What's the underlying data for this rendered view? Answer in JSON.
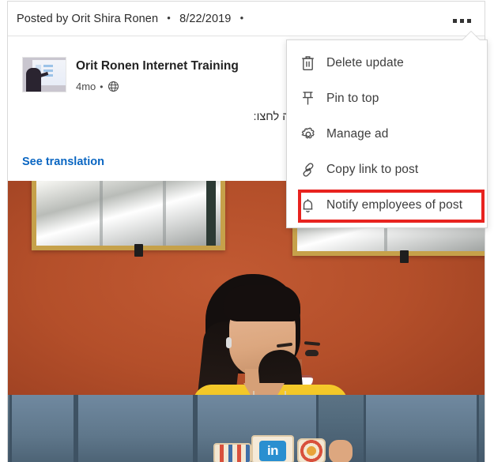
{
  "post": {
    "header": {
      "posted_by_prefix": "Posted by",
      "author": "Orit Shira Ronen",
      "date": "8/22/2019",
      "separator": "•",
      "more_icon": "ellipsis-icon"
    },
    "author_card": {
      "name": "Orit Ronen Internet Training",
      "time_ago": "4mo",
      "meta_separator": "•",
      "visibility_icon": "globe-icon",
      "avatar_icon": "company-avatar"
    },
    "text": "ין שיווק בלינקדאין לעולם הגיוס. לקריאה לחצו:",
    "see_translation": "See translation",
    "photo": {
      "description": "Woman in yellow floral top seated on blue sofa holding LinkedIn cookies",
      "linkedin_cookie_label": "in",
      "wall_color": "#b44f2a",
      "sofa_color": "#5c7385",
      "frame_color": "#c6a14a",
      "blouse_color": "#f0c422"
    }
  },
  "dropdown": {
    "items": [
      {
        "label": "Delete update",
        "icon": "trash-icon"
      },
      {
        "label": "Pin to top",
        "icon": "pin-icon"
      },
      {
        "label": "Manage ad",
        "icon": "gear-icon"
      },
      {
        "label": "Copy link to post",
        "icon": "link-icon"
      },
      {
        "label": "Notify employees of post",
        "icon": "bell-icon"
      }
    ]
  },
  "annotation": {
    "highlight_color": "#e8231f",
    "target": "Notify employees of post"
  },
  "colors": {
    "link": "#0a66c2",
    "text": "#2b2b2b",
    "border": "#d9d9d9"
  }
}
